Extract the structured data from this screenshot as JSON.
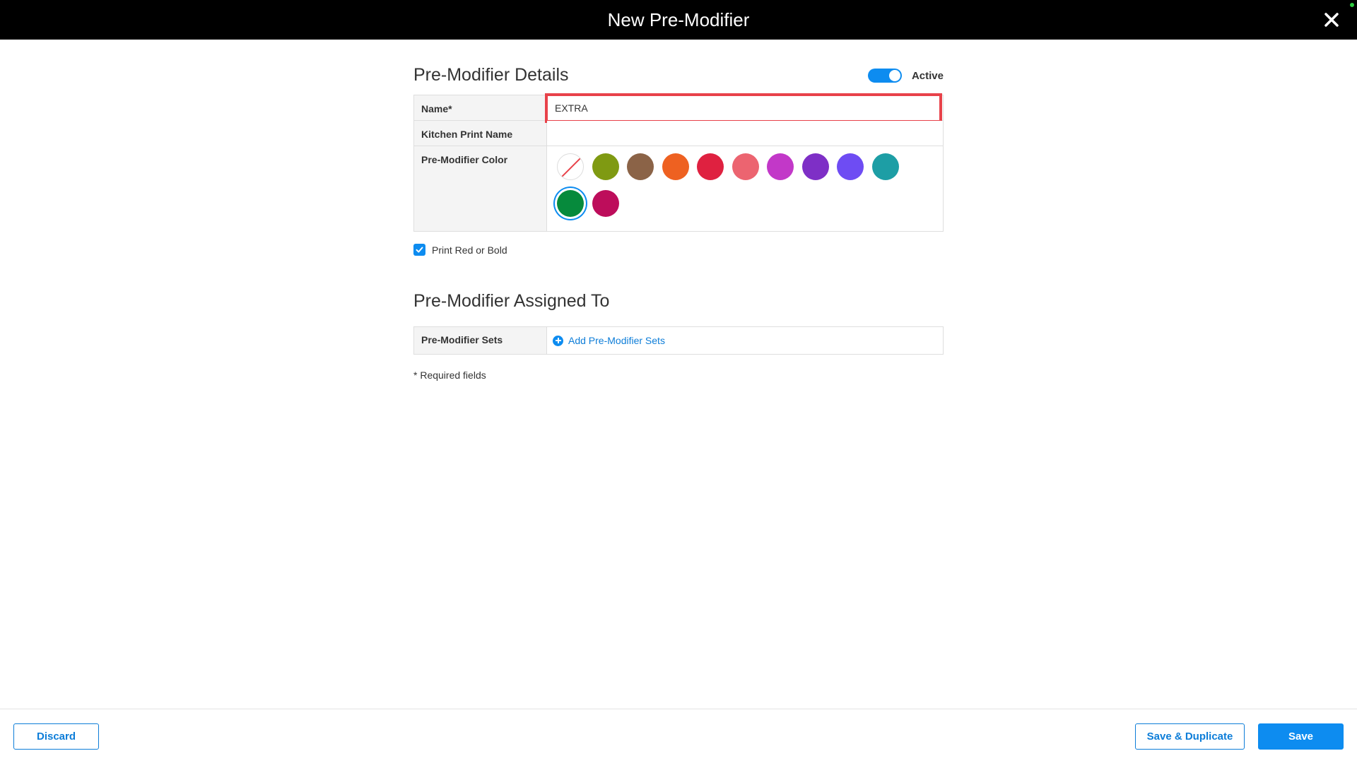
{
  "header": {
    "title": "New Pre-Modifier",
    "close_icon": "close-icon"
  },
  "details": {
    "title": "Pre-Modifier Details",
    "active_label": "Active",
    "active_on": true,
    "fields": {
      "name_label": "Name*",
      "name_value": "EXTRA",
      "kitchen_label": "Kitchen Print Name",
      "kitchen_value": "",
      "color_label": "Pre-Modifier Color"
    },
    "colors": [
      {
        "name": "none",
        "hex": "#ffffff"
      },
      {
        "name": "olive",
        "hex": "#7f9a12"
      },
      {
        "name": "brown",
        "hex": "#8b6347"
      },
      {
        "name": "orange",
        "hex": "#ee6121"
      },
      {
        "name": "red",
        "hex": "#df2140"
      },
      {
        "name": "salmon",
        "hex": "#ec6470"
      },
      {
        "name": "magenta",
        "hex": "#c238c8"
      },
      {
        "name": "purple",
        "hex": "#7e2fc6"
      },
      {
        "name": "violet",
        "hex": "#6e4cf3"
      },
      {
        "name": "teal",
        "hex": "#1d9ea5"
      },
      {
        "name": "green",
        "hex": "#068a3c"
      },
      {
        "name": "crimson",
        "hex": "#bd0d5b"
      }
    ],
    "selected_color": "green",
    "print_red_bold_label": "Print Red or Bold",
    "print_red_bold_checked": true
  },
  "assigned": {
    "title": "Pre-Modifier Assigned To",
    "sets_label": "Pre-Modifier Sets",
    "add_sets_label": "Add Pre-Modifier Sets",
    "add_icon": "plus-circle-icon"
  },
  "required_note": "* Required fields",
  "footer": {
    "discard_label": "Discard",
    "save_duplicate_label": "Save & Duplicate",
    "save_label": "Save"
  }
}
